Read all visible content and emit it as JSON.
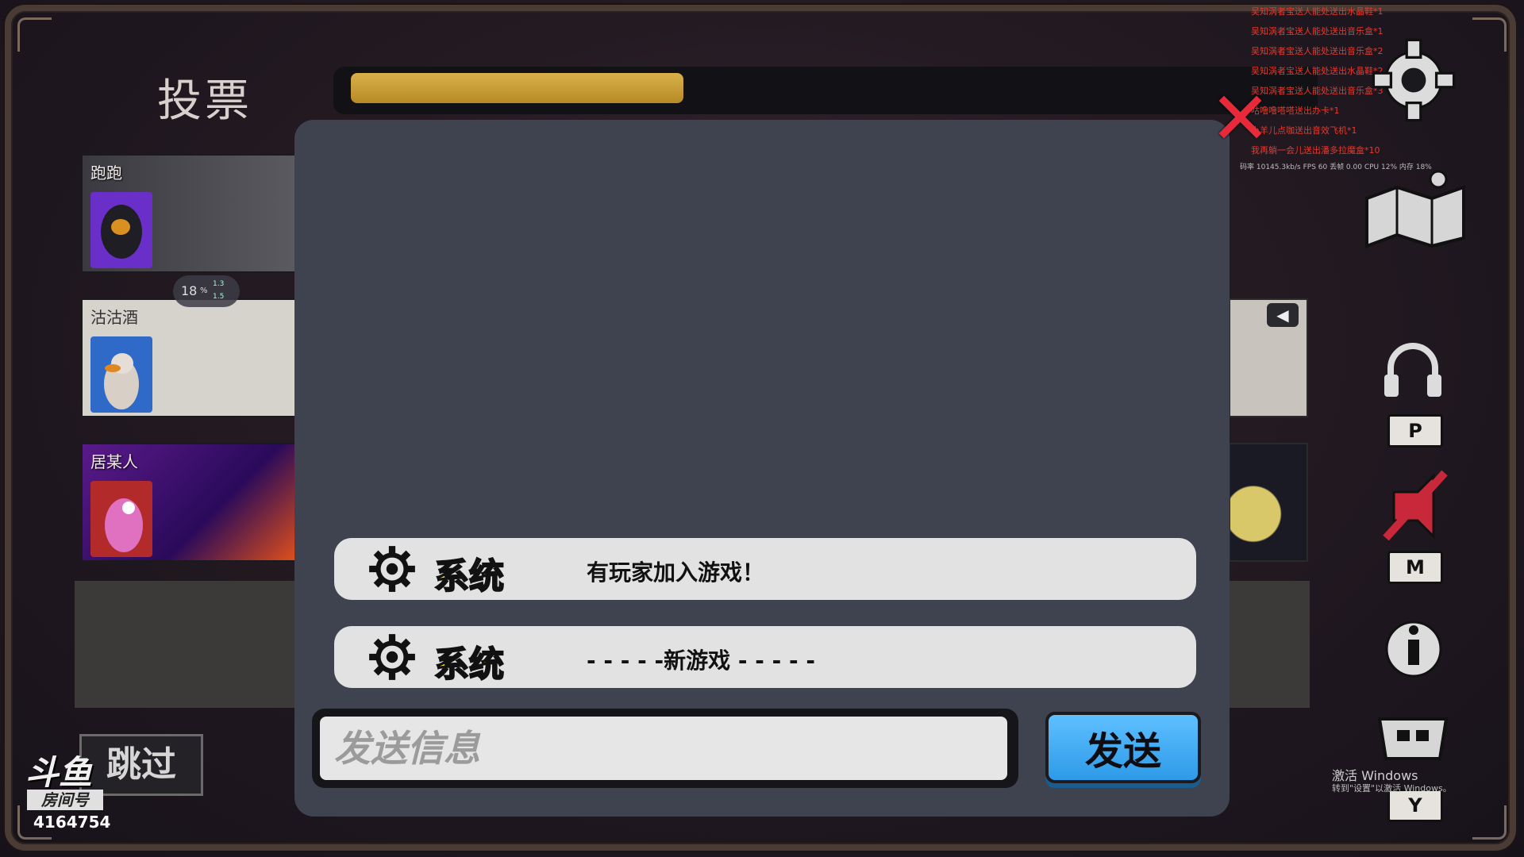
{
  "screen": {
    "title": "投票",
    "vote_timer_progress": 0.35
  },
  "players": [
    {
      "name": "跑跑",
      "avatar_color": "#6a2fc9"
    },
    {
      "name": "沽沽酒",
      "avatar_color": "#2f6ac9"
    },
    {
      "name": "居某人",
      "avatar_color": "#b32a2a"
    }
  ],
  "network": {
    "percent": "18",
    "unit": "%",
    "up": "1.3",
    "down": "1.5"
  },
  "chat": {
    "messages": [
      {
        "sender": "系统",
        "text": "有玩家加入游戏！"
      },
      {
        "sender": "系统",
        "text": "- - - - -新游戏 - - - - -"
      }
    ],
    "input_placeholder": "发送信息",
    "send_label": "发送"
  },
  "gift_feed": [
    "吴知涡者宝送人能处送出水晶鞋*1",
    "吴知涡者宝送人能处送出音乐盒*1",
    "吴知涡者宝送人能处送出音乐盒*2",
    "吴知涡者宝送人能处送出水晶鞋*2",
    "吴知涡者宝送人能处送出音乐盒*3",
    "咕噜噜嗒嗒送出办卡*1",
    "小羊儿点咖送出音效飞机*1",
    "我再躺一会儿送出潘多拉魔盒*10"
  ],
  "perf_text": "码率 10145.3kb/s FPS 60 丢帧 0.00 CPU 12% 内存 18%",
  "side_keys": {
    "mic_key": "P",
    "mute_key": "M",
    "tasks_key": "Y"
  },
  "skip_label": "跳过",
  "stream": {
    "logo": "斗鱼",
    "room_label": "房间号",
    "room_number": "4164754"
  },
  "watermark": {
    "line1": "激活 Windows",
    "line2": "转到\"设置\"以激活 Windows。"
  },
  "colors": {
    "accent_yellow": "#ffe60a",
    "send_blue": "#3ea8f0",
    "close_red": "#e8293a",
    "timer_gold": "#c99e38",
    "dialog_bg": "#3f4350"
  }
}
